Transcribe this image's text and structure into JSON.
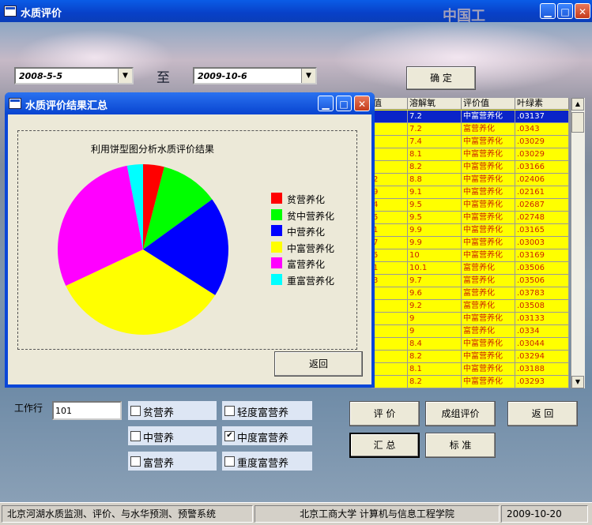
{
  "window": {
    "title": "水质评价"
  },
  "date_from": "2008-5-5",
  "to_label": "至",
  "date_to": "2009-10-6",
  "confirm_label": "确 定",
  "grid": {
    "headers": [
      "值",
      "溶解氧",
      "评价值",
      "叶绿素"
    ],
    "rows": [
      [
        "",
        "7.2",
        "中富营养化",
        ".03137"
      ],
      [
        "",
        "7.2",
        "富营养化",
        ".0343"
      ],
      [
        "",
        "7.4",
        "中富营养化",
        ".03029"
      ],
      [
        "",
        "8.1",
        "中富营养化",
        ".03029"
      ],
      [
        "",
        "8.2",
        "中富营养化",
        ".03166"
      ],
      [
        "2",
        "8.8",
        "中富营养化",
        ".02406"
      ],
      [
        "9",
        "9.1",
        "中富营养化",
        ".02161"
      ],
      [
        "4",
        "9.5",
        "中富营养化",
        ".02687"
      ],
      [
        "5",
        "9.5",
        "中富营养化",
        ".02748"
      ],
      [
        "1",
        "9.9",
        "中富营养化",
        ".03165"
      ],
      [
        "7",
        "9.9",
        "中富营养化",
        ".03003"
      ],
      [
        "5",
        "10",
        "中富营养化",
        ".03169"
      ],
      [
        "1",
        "10.1",
        "富营养化",
        ".03506"
      ],
      [
        "3",
        "9.7",
        "富营养化",
        ".03506"
      ],
      [
        "",
        "9.6",
        "富营养化",
        ".03783"
      ],
      [
        "",
        "9.2",
        "富营养化",
        ".03508"
      ],
      [
        "",
        "9",
        "中富营养化",
        ".03133"
      ],
      [
        "",
        "9",
        "富营养化",
        ".0334"
      ],
      [
        "",
        "8.4",
        "中富营养化",
        ".03044"
      ],
      [
        "",
        "8.2",
        "中富营养化",
        ".03294"
      ],
      [
        "",
        "8.1",
        "中富营养化",
        ".03188"
      ],
      [
        "",
        "8.2",
        "中富营养化",
        ".03293"
      ]
    ]
  },
  "dialog": {
    "title": "水质评价结果汇总",
    "return_label": "返回"
  },
  "chart_data": {
    "type": "pie",
    "title": "利用饼型图分析水质评价结果",
    "legend_position": "right",
    "slices": [
      {
        "name": "贫营养化",
        "value": 4,
        "color": "#ff0000"
      },
      {
        "name": "贫中营养化",
        "value": 11,
        "color": "#00ff00"
      },
      {
        "name": "中营养化",
        "value": 19,
        "color": "#0000ff"
      },
      {
        "name": "中富营养化",
        "value": 34,
        "color": "#ffff00"
      },
      {
        "name": "富营养化",
        "value": 29,
        "color": "#ff00ff"
      },
      {
        "name": "重富营养化",
        "value": 3,
        "color": "#00ffff"
      }
    ]
  },
  "work_row": {
    "label": "工作行",
    "value": "101"
  },
  "checkboxes": [
    {
      "label": "贫营养",
      "checked": false
    },
    {
      "label": "轻度富营养",
      "checked": false
    },
    {
      "label": "中营养",
      "checked": false
    },
    {
      "label": "中度富营养",
      "checked": true
    },
    {
      "label": "富营养",
      "checked": false
    },
    {
      "label": "重度富营养",
      "checked": false
    }
  ],
  "buttons": {
    "evaluate": "评 价",
    "group_evaluate": "成组评价",
    "back": "返 回",
    "summary": "汇 总",
    "standard": "标 准"
  },
  "status": {
    "system_name": "北京河湖水质监测、评价、与水华预测、预警系统",
    "institution": "北京工商大学 计算机与信息工程学院",
    "date": "2009-10-20"
  },
  "watermark": "中国工",
  "icons": {
    "window_icon": "app-window-icon",
    "minimize": "minimize-icon",
    "maximize": "maximize-icon",
    "close": "close-icon",
    "dropdown": "chevron-down-icon",
    "scroll_up": "arrow-up-icon",
    "scroll_down": "arrow-down-icon",
    "checkmark": "check-icon"
  }
}
